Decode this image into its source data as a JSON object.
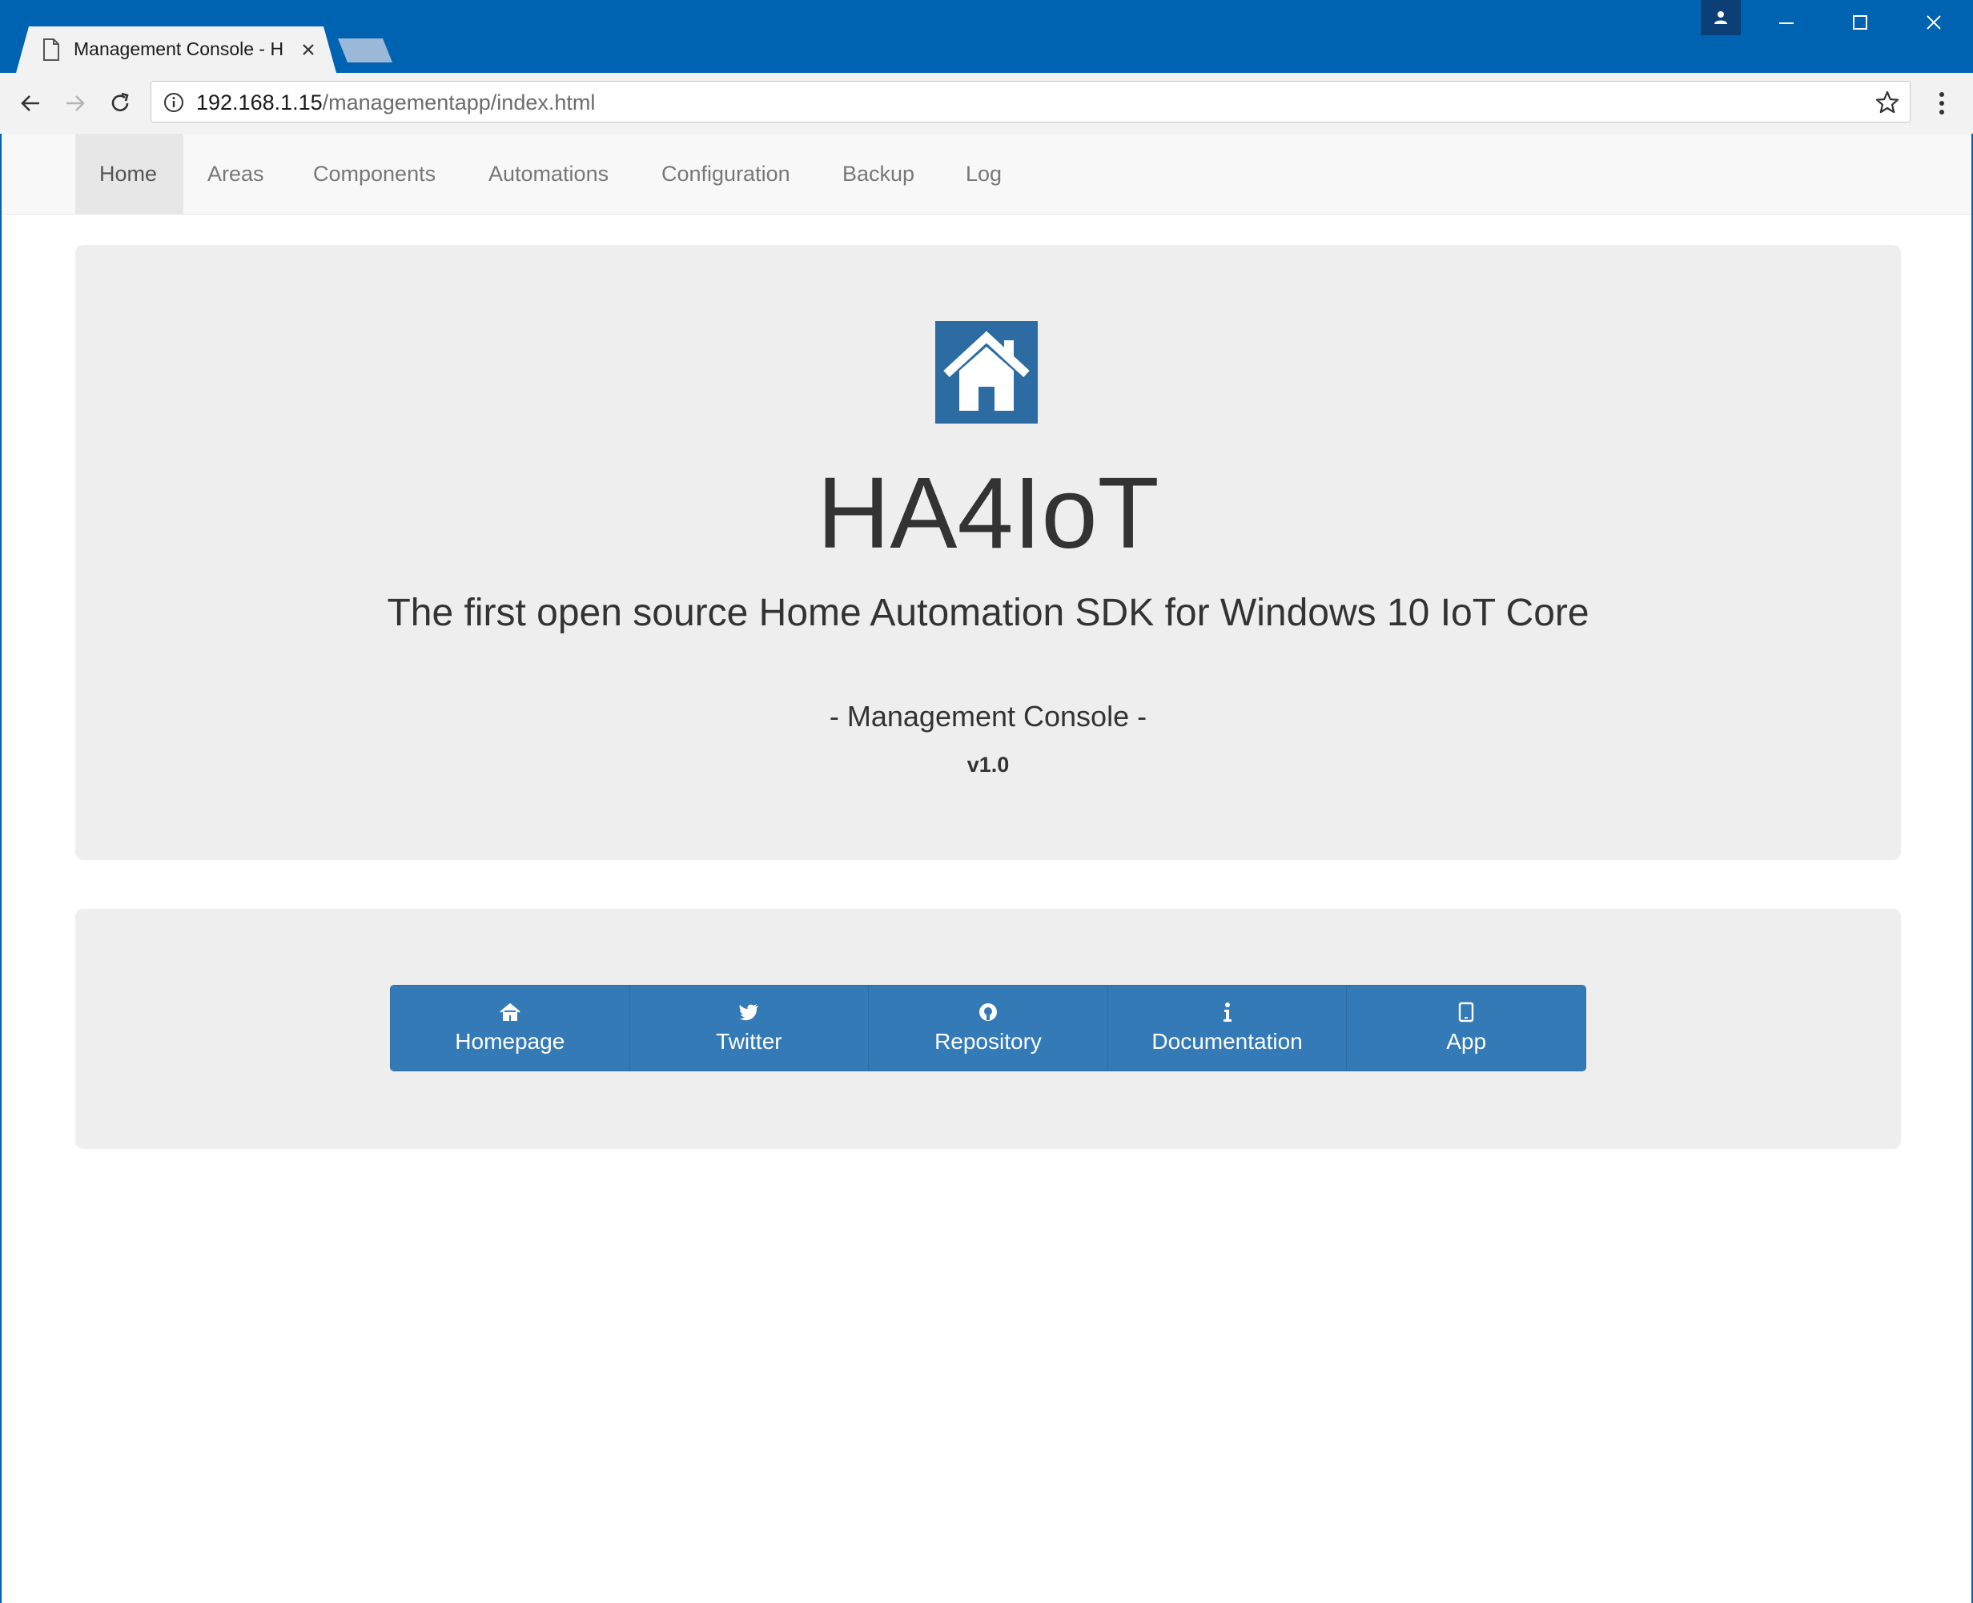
{
  "browser": {
    "tab_title": "Management Console - H",
    "url_host": "192.168.1.15",
    "url_path": "/managementapp/index.html"
  },
  "navbar": {
    "items": [
      {
        "label": "Home",
        "active": true
      },
      {
        "label": "Areas"
      },
      {
        "label": "Components"
      },
      {
        "label": "Automations"
      },
      {
        "label": "Configuration"
      },
      {
        "label": "Backup"
      },
      {
        "label": "Log"
      }
    ]
  },
  "hero": {
    "logo_icon": "home-icon",
    "title": "HA4IoT",
    "tagline": "The first open source Home Automation SDK for Windows 10 IoT Core",
    "subtitle": "- Management Console -",
    "version": "v1.0"
  },
  "links": [
    {
      "label": "Homepage",
      "icon": "home-icon"
    },
    {
      "label": "Twitter",
      "icon": "twitter-icon"
    },
    {
      "label": "Repository",
      "icon": "github-icon"
    },
    {
      "label": "Documentation",
      "icon": "info-icon"
    },
    {
      "label": "App",
      "icon": "tablet-icon"
    }
  ],
  "colors": {
    "titlebar": "#0063b1",
    "accent": "#337ab7",
    "logo_bg": "#2d6ca2",
    "panel_bg": "#eeeeee"
  }
}
